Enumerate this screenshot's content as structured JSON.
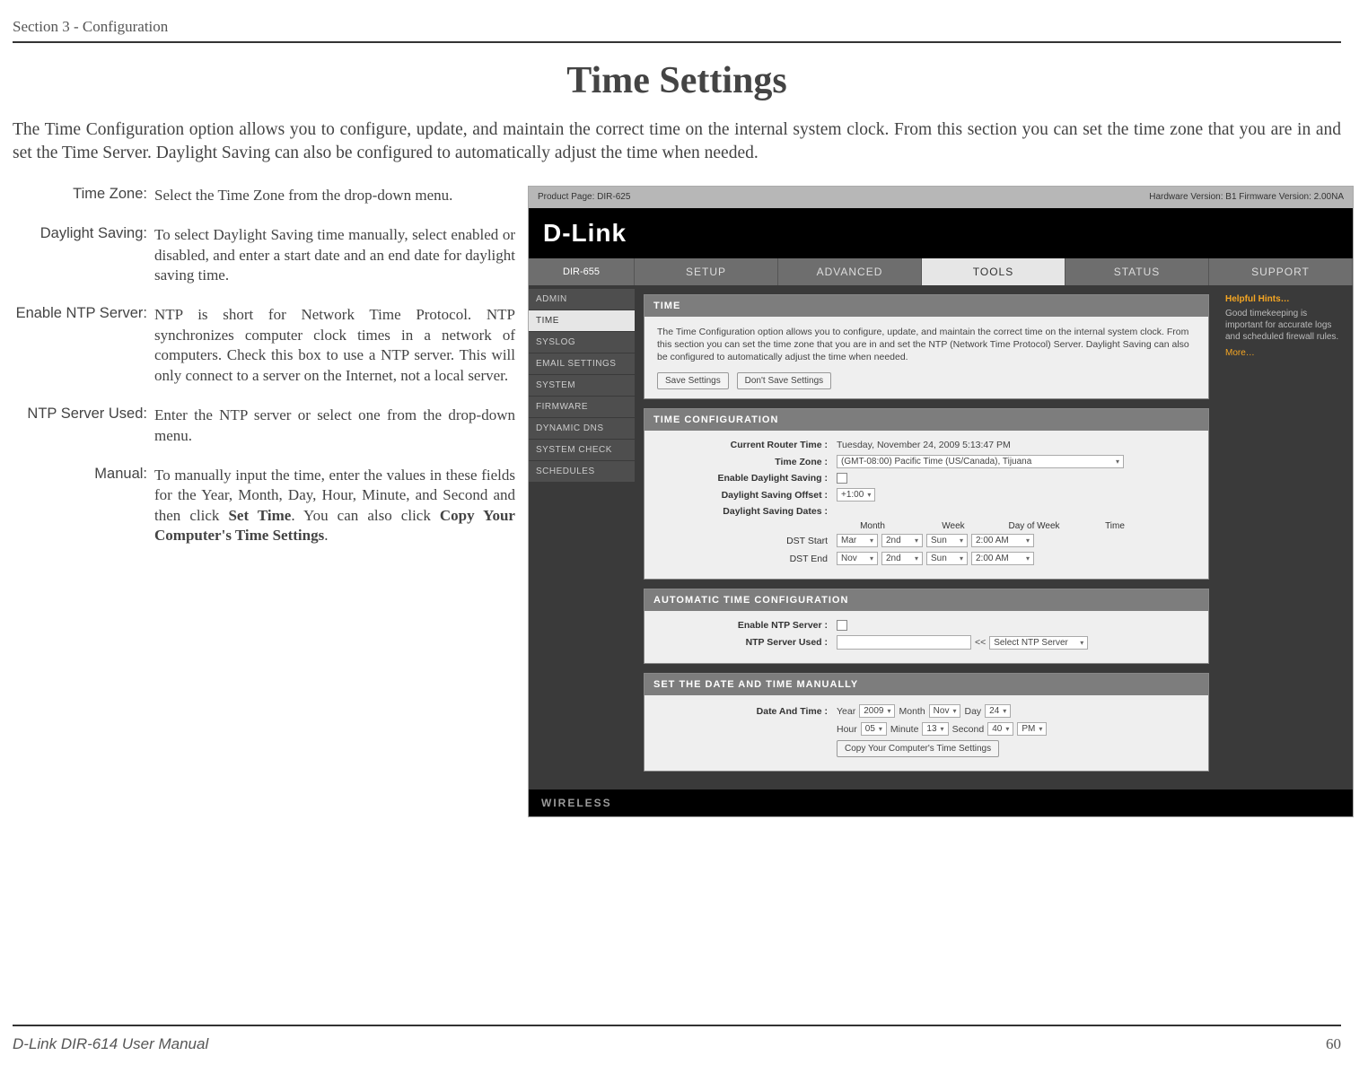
{
  "section_header": "Section 3 - Configuration",
  "page_title": "Time Settings",
  "intro": "The Time Configuration option allows you to configure, update, and maintain the correct time on the internal system clock. From this section you can set the time zone that you are in and set the Time Server. Daylight Saving can also be configured to automatically adjust the time when needed.",
  "defs": {
    "time_zone": {
      "label": "Time Zone:",
      "text": "Select the Time Zone from the drop-down menu."
    },
    "daylight": {
      "label": "Daylight Saving:",
      "text": "To select Daylight Saving time manually, select enabled or disabled, and enter a start date and an end date for daylight saving time."
    },
    "enable_ntp": {
      "label": "Enable NTP Server:",
      "text": "NTP is short for Network Time Protocol. NTP synchronizes computer clock times in a network of computers. Check this box to use a NTP server. This will only connect to a server on the Internet, not a local server."
    },
    "ntp_used": {
      "label": "NTP Server Used:",
      "text": "Enter the NTP server or select one from the drop-down menu."
    },
    "manual": {
      "label": "Manual:",
      "text_pre": "To manually input the time, enter the values in these fields for the Year, Month, Day, Hour, Minute, and Second and then click ",
      "b1": "Set Time",
      "mid": ". You can also click ",
      "b2": "Copy Your Computer's Time Settings",
      "post": "."
    }
  },
  "shot": {
    "top_left": "Product Page: DIR-625",
    "top_right": "Hardware Version: B1    Firmware Version: 2.00NA",
    "logo": "D-Link",
    "model": "DIR-655",
    "tabs": {
      "setup": "SETUP",
      "advanced": "ADVANCED",
      "tools": "TOOLS",
      "status": "STATUS",
      "support": "SUPPORT"
    },
    "side": [
      "ADMIN",
      "TIME",
      "SYSLOG",
      "EMAIL SETTINGS",
      "SYSTEM",
      "FIRMWARE",
      "DYNAMIC DNS",
      "SYSTEM CHECK",
      "SCHEDULES"
    ],
    "help": {
      "title": "Helpful Hints…",
      "desc": "Good timekeeping is important for accurate logs and scheduled firewall rules.",
      "more": "More…"
    },
    "time_panel": {
      "head": "TIME",
      "desc": "The Time Configuration option allows you to configure, update, and maintain the correct time on the internal system clock. From this section you can set the time zone that you are in and set the NTP (Network Time Protocol) Server. Daylight Saving can also be configured to automatically adjust the time when needed.",
      "save": "Save Settings",
      "dont": "Don't Save Settings"
    },
    "tc_panel": {
      "head": "TIME CONFIGURATION",
      "crt_lab": "Current Router Time :",
      "crt_val": "Tuesday, November 24, 2009 5:13:47 PM",
      "tz_lab": "Time Zone :",
      "tz_val": "(GMT-08:00) Pacific Time (US/Canada), Tijuana",
      "eds_lab": "Enable Daylight Saving :",
      "dso_lab": "Daylight Saving Offset :",
      "dso_val": "+1:00",
      "dsd_lab": "Daylight Saving Dates :",
      "cols": {
        "month": "Month",
        "week": "Week",
        "dow": "Day of Week",
        "time": "Time"
      },
      "start_lab": "DST Start",
      "end_lab": "DST End",
      "start": {
        "m": "Mar",
        "w": "2nd",
        "d": "Sun",
        "t": "2:00 AM"
      },
      "end": {
        "m": "Nov",
        "w": "2nd",
        "d": "Sun",
        "t": "2:00 AM"
      }
    },
    "auto_panel": {
      "head": "AUTOMATIC TIME CONFIGURATION",
      "en_lab": "Enable NTP Server :",
      "used_lab": "NTP Server Used :",
      "sel": "Select NTP Server"
    },
    "manual_panel": {
      "head": "SET THE DATE AND TIME MANUALLY",
      "dt_lab": "Date And Time :",
      "year_l": "Year",
      "year_v": "2009",
      "month_l": "Month",
      "month_v": "Nov",
      "day_l": "Day",
      "day_v": "24",
      "hour_l": "Hour",
      "hour_v": "05",
      "min_l": "Minute",
      "min_v": "13",
      "sec_l": "Second",
      "sec_v": "40",
      "pm": "PM",
      "copy": "Copy Your Computer's Time Settings"
    },
    "wireless": "WIRELESS"
  },
  "footer": {
    "left": "D-Link DIR-614 User Manual",
    "right": "60"
  }
}
